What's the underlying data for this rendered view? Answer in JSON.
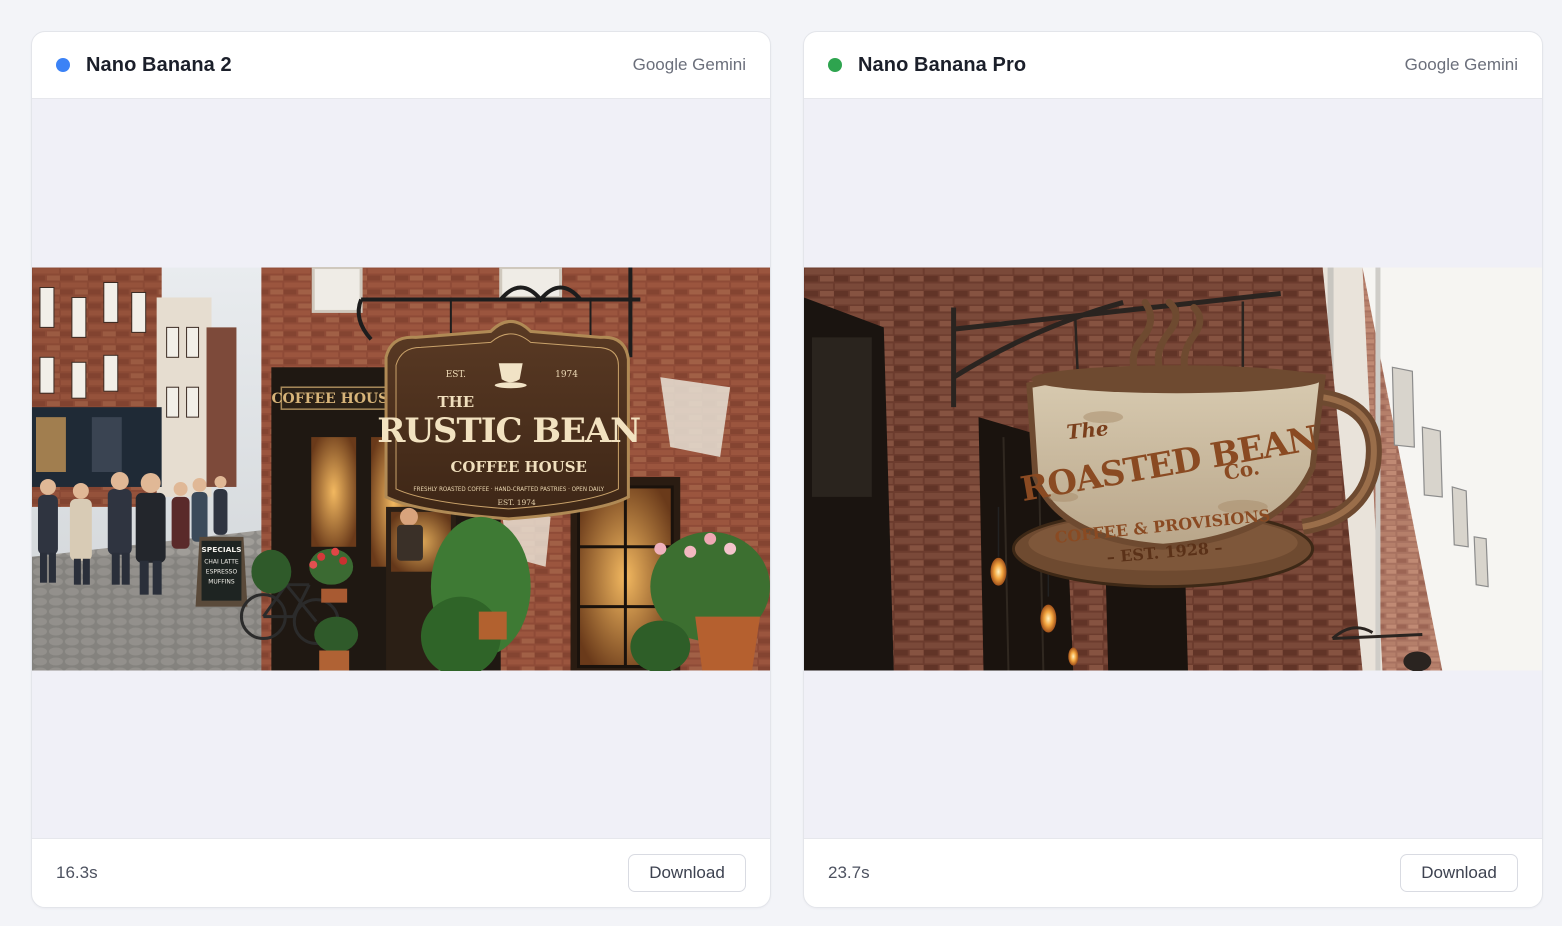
{
  "cards": [
    {
      "model_name": "Nano Banana 2",
      "provider": "Google Gemini",
      "status_color": "#3b82f6",
      "duration": "16.3s",
      "download_label": "Download",
      "image": {
        "sign_top_left": "EST.",
        "sign_top_right": "1974",
        "sign_the": "THE",
        "sign_name": "RUSTIC BEAN",
        "sign_sub": "COFFEE HOUSE",
        "sign_tagline": "FRESHLY ROASTED COFFEE · HAND-CRAFTED PASTRIES · OPEN DAILY",
        "sign_est": "EST. 1974",
        "awning_text": "COFFEE HOUSE",
        "board_lines": [
          "SPECIALS",
          "CHAI LATTE",
          "ESPRESSO",
          "MUFFINS"
        ]
      }
    },
    {
      "model_name": "Nano Banana Pro",
      "provider": "Google Gemini",
      "status_color": "#2ea44f",
      "duration": "23.7s",
      "download_label": "Download",
      "image": {
        "sign_the": "The",
        "sign_name": "ROASTED BEAN",
        "sign_co": "Co.",
        "sign_sub": "COFFEE & PROVISIONS",
        "sign_est": "– EST. 1928 –"
      }
    }
  ]
}
